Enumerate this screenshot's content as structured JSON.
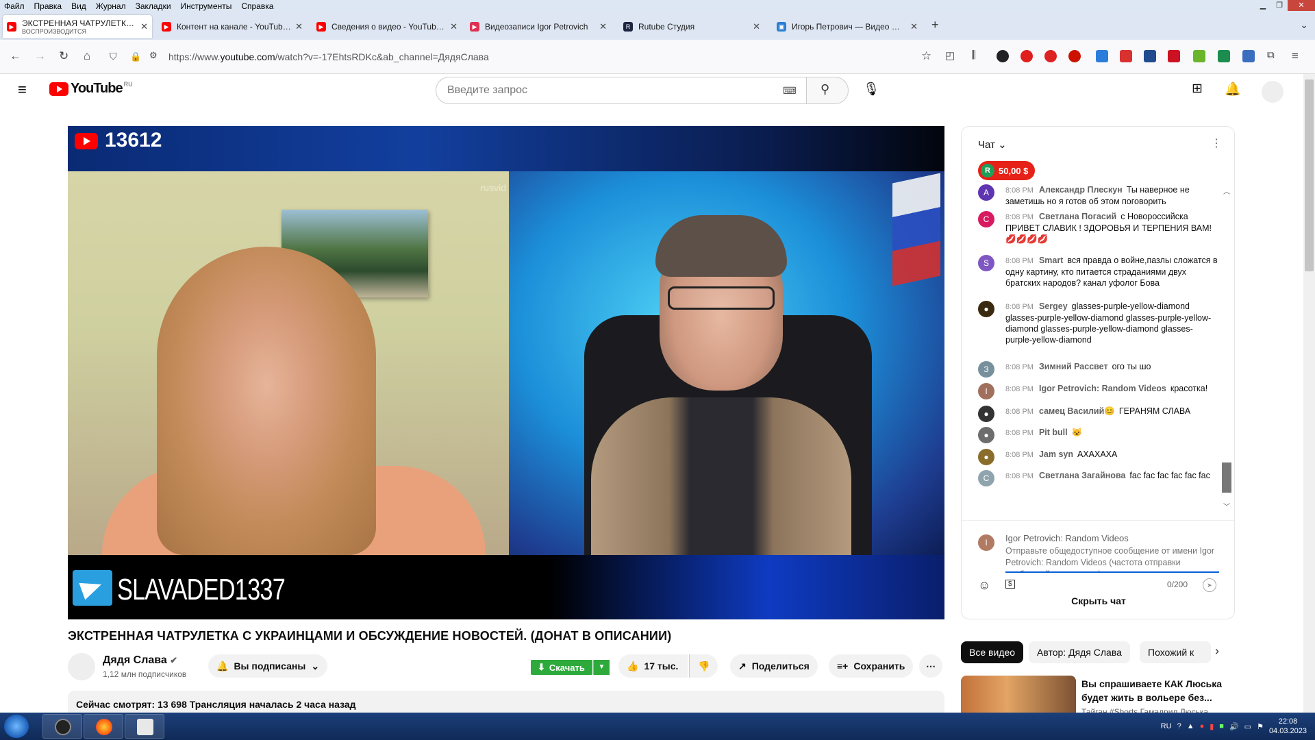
{
  "menubar": {
    "items": [
      "Файл",
      "Правка",
      "Вид",
      "Журнал",
      "Закладки",
      "Инструменты",
      "Справка"
    ]
  },
  "tabs": [
    {
      "title": "ЭКСТРЕННАЯ ЧАТРУЛЕТКА С УКР",
      "subtitle": "ВОСПРОИЗВОДИТСЯ",
      "favicon": "youtube-icon",
      "color": "#ff0000"
    },
    {
      "title": "Контент на канале - YouTube St",
      "favicon": "youtube-icon",
      "color": "#ff0000"
    },
    {
      "title": "Сведения о видео - YouTube St",
      "favicon": "youtube-icon",
      "color": "#ff0000"
    },
    {
      "title": "Видеозаписи Igor Petrovich",
      "favicon": "video-icon",
      "color": "#e03050"
    },
    {
      "title": "Rutube Студия",
      "favicon": "rutube-icon",
      "color": "#1b2440",
      "glyph": "R"
    },
    {
      "title": "Игорь Петрович — Видео Mail",
      "favicon": "mail-video-icon",
      "color": "#2a7fd4"
    }
  ],
  "address": {
    "url_prefix": "https://www.",
    "url_domain": "youtube.com",
    "url_rest": "/watch?v=-17EhtsRDKc&ab_channel=ДядяСлава"
  },
  "youtube": {
    "logo_text": "YouTube",
    "region": "RU",
    "search_placeholder": "Введите запрос"
  },
  "video": {
    "overlay_count": "13612",
    "overlay_channel": "SLAVADED1337",
    "watermark": "rusvid",
    "title": "ЭКСТРЕННАЯ ЧАТРУЛЕТКА С УКРАИНЦАМИ И ОБСУЖДЕНИЕ НОВОСТЕЙ. (ДОНАТ В ОПИСАНИИ)"
  },
  "channel": {
    "name": "Дядя Слава",
    "subscribers": "1,12 млн подписчиков",
    "subscribed_label": "Вы подписаны"
  },
  "actions": {
    "download": "Скачать",
    "likes": "17 тыс.",
    "share": "Поделиться",
    "save": "Сохранить"
  },
  "description": {
    "text": "Сейчас смотрят: 13 698  Трансляция началась 2 часа назад"
  },
  "chat": {
    "header": "Чат",
    "donation": {
      "avatar_letter": "R",
      "amount": "50,00 $"
    },
    "messages": [
      {
        "time": "8:08 PM",
        "author": "Александр Плескун",
        "text": "Ты наверное не заметишь но я готов об этом поговорить",
        "avatar": "A",
        "color": "#5e35b1"
      },
      {
        "time": "8:08 PM",
        "author": "Светлана Погасий",
        "text": "с Новороссийска ПРИВЕТ СЛАВИК ! ЗДОРОВЬЯ И ТЕРПЕНИЯ ВАМ! 💋💋💋💋",
        "avatar": "С",
        "color": "#d81b60"
      },
      {
        "time": "8:08 PM",
        "author": "Smart",
        "text": "вся правда о войне,пазлы сложатся в одну картину, кто питается страданиями двух братских народов? канал уфолог Бова",
        "avatar": "S",
        "color": "#7e57c2"
      },
      {
        "time": "8:08 PM",
        "author": "Sergey",
        "text": "glasses-purple-yellow-diamond glasses-purple-yellow-diamond glasses-purple-yellow-diamond glasses-purple-yellow-diamond glasses-purple-yellow-diamond",
        "avatar": "",
        "color": "#3a2a10"
      },
      {
        "time": "8:08 PM",
        "author": "Зимний Рассвет",
        "text": "ого ты шо",
        "avatar": "З",
        "color": "#78909c"
      },
      {
        "time": "8:08 PM",
        "author": "Igor Petrovich: Random Videos",
        "text": "красотка!",
        "avatar": "I",
        "color": "#a1705c"
      },
      {
        "time": "8:08 PM",
        "author": "самец Василий😊",
        "text": "ГЕРАНЯМ СЛАВА",
        "avatar": "",
        "color": "#333333"
      },
      {
        "time": "8:08 PM",
        "author": "Pit bull",
        "text": "😺",
        "avatar": "",
        "color": "#6d6d6d"
      },
      {
        "time": "8:08 PM",
        "author": "Jam syn",
        "text": "АХАХАХА",
        "avatar": "",
        "color": "#8a6d2a"
      },
      {
        "time": "8:08 PM",
        "author": "Светлана Загайнова",
        "text": "fac  fac  fac  fac  fac  fac",
        "avatar": "С",
        "color": "#90a4ae"
      }
    ],
    "composer": {
      "author": "Igor Petrovich: Random Videos",
      "avatar": "I",
      "placeholder": "Отправьте общедоступное сообщение от имени Igor Petrovich: Random Videos (частота отправки сообщений ограничена)",
      "counter": "0/200"
    },
    "hide_label": "Скрыть чат"
  },
  "filters": [
    "Все видео",
    "Автор: Дядя Слава",
    "Похожий к"
  ],
  "recommendation": {
    "title": "Вы спрашиваете КАК Люська будет жить в вольере без...",
    "subtitle": "Тайган #Shorts Гамадрил Люська"
  },
  "taskbar": {
    "lang": "RU",
    "time": "22:08",
    "date": "04.03.2023"
  }
}
